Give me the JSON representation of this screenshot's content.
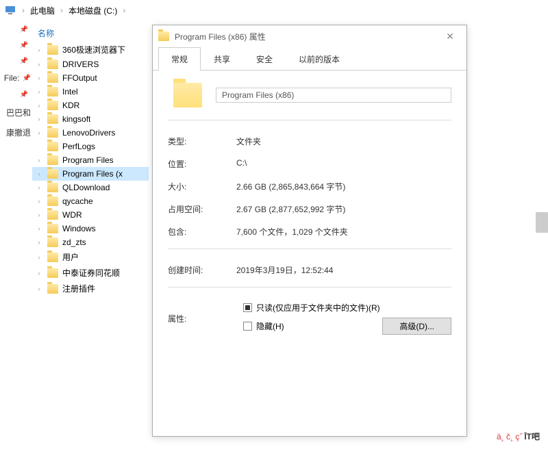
{
  "breadcrumb": {
    "root": "此电脑",
    "drive": "本地磁盘 (C:)"
  },
  "quick_access": [
    {
      "label": ""
    },
    {
      "label": ""
    },
    {
      "label": ""
    },
    {
      "label": "File:"
    },
    {
      "label": ""
    },
    {
      "label": "巴巴和"
    },
    {
      "label": "康撤退"
    }
  ],
  "tree": {
    "header": "名称",
    "items": [
      {
        "label": "360极速浏览器下",
        "selected": false
      },
      {
        "label": "DRIVERS",
        "selected": false
      },
      {
        "label": "FFOutput",
        "selected": false
      },
      {
        "label": "Intel",
        "selected": false
      },
      {
        "label": "KDR",
        "selected": false
      },
      {
        "label": "kingsoft",
        "selected": false
      },
      {
        "label": "LenovoDrivers",
        "selected": false
      },
      {
        "label": "PerfLogs",
        "selected": false
      },
      {
        "label": "Program Files",
        "selected": false
      },
      {
        "label": "Program Files (x",
        "selected": true
      },
      {
        "label": "QLDownload",
        "selected": false
      },
      {
        "label": "qycache",
        "selected": false
      },
      {
        "label": "WDR",
        "selected": false
      },
      {
        "label": "Windows",
        "selected": false
      },
      {
        "label": "zd_zts",
        "selected": false
      },
      {
        "label": "用户",
        "selected": false
      },
      {
        "label": "中泰证券同花顺",
        "selected": false
      },
      {
        "label": "注册插件",
        "selected": false
      }
    ]
  },
  "dialog": {
    "title": "Program Files (x86) 属性",
    "tabs": {
      "general": "常规",
      "sharing": "共享",
      "security": "安全",
      "previous": "以前的版本"
    },
    "name_value": "Program Files (x86)",
    "props": {
      "type_label": "类型:",
      "type_value": "文件夹",
      "location_label": "位置:",
      "location_value": "C:\\",
      "size_label": "大小:",
      "size_value": "2.66 GB (2,865,843,664 字节)",
      "disk_label": "占用空间:",
      "disk_value": "2.67 GB (2,877,652,992 字节)",
      "contains_label": "包含:",
      "contains_value": "7,600 个文件，1,029 个文件夹",
      "created_label": "创建时间:",
      "created_value": "2019年3月19日，12:52:44",
      "attr_label": "属性:",
      "readonly_label": "只读(仅应用于文件夹中的文件)(R)",
      "hidden_label": "隐藏(H)",
      "advanced_label": "高级(D)..."
    }
  },
  "watermark": {
    "glyphs": "ä¸ č¸ ç˝",
    "brand": "ĪT吧"
  }
}
